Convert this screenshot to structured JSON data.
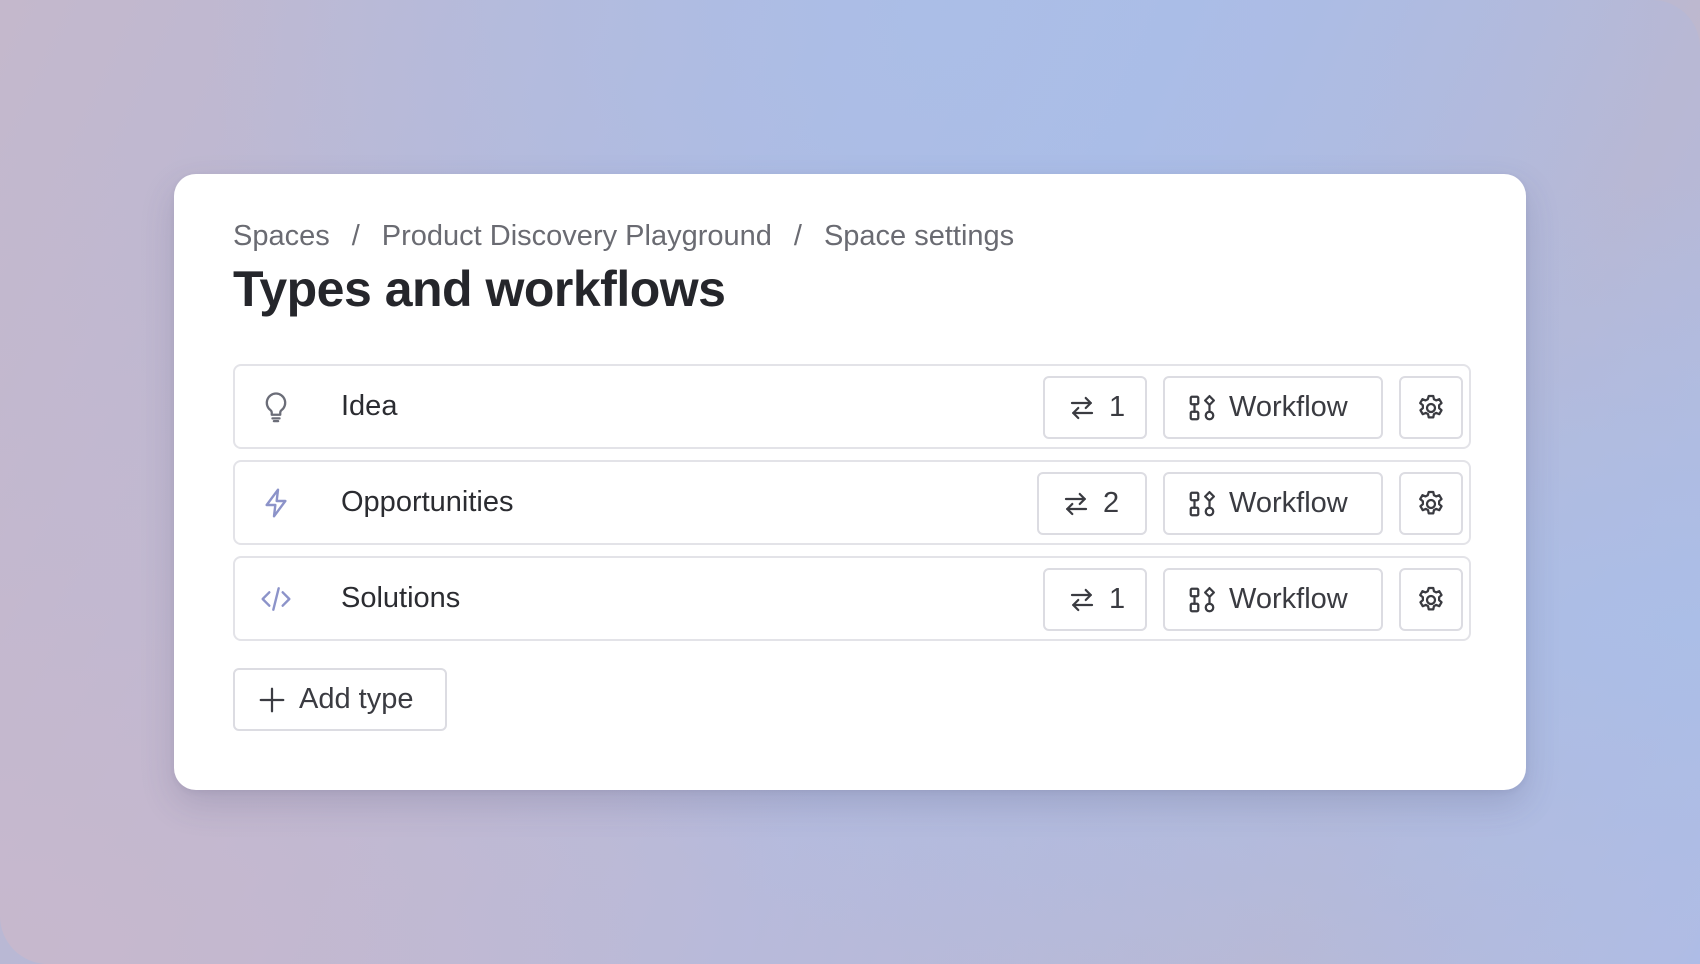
{
  "breadcrumb": {
    "items": [
      "Spaces",
      "Product Discovery Playground",
      "Space settings"
    ],
    "separator": "/"
  },
  "page": {
    "title": "Types and workflows"
  },
  "types": [
    {
      "label": "Idea",
      "icon": "lightbulb-icon",
      "icon_color": "#6b6d78",
      "count": "1",
      "workflow_label": "Workflow"
    },
    {
      "label": "Opportunities",
      "icon": "lightning-icon",
      "icon_color": "#8c93c9",
      "count": "2",
      "workflow_label": "Workflow"
    },
    {
      "label": "Solutions",
      "icon": "code-icon",
      "icon_color": "#8c93c9",
      "count": "1",
      "workflow_label": "Workflow"
    }
  ],
  "actions": {
    "add_type_label": "Add type"
  },
  "colors": {
    "card_background": "#ffffff",
    "title_text": "#25262b",
    "muted_text": "#6a6b72",
    "border": "#e3e3e8",
    "accent_icon": "#8c93c9"
  }
}
